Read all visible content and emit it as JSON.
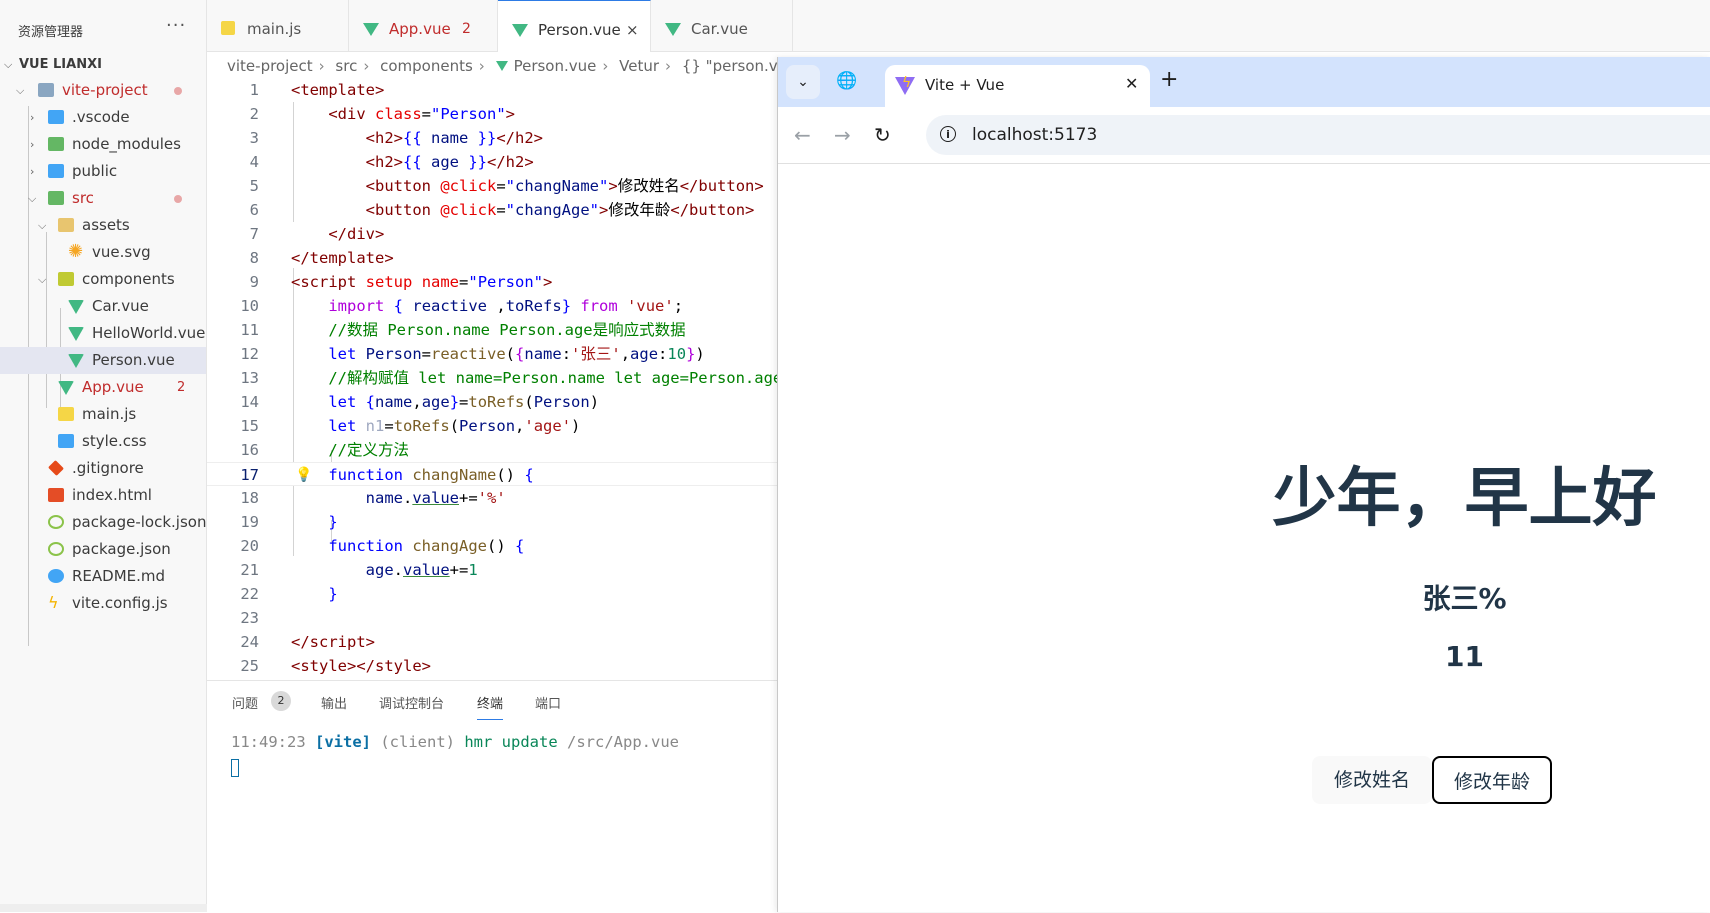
{
  "explorer": {
    "title": "资源管理器",
    "more": "···",
    "project": "VUE LIANXI",
    "tree": [
      {
        "label": "vite-project",
        "modified": true
      },
      {
        "label": ".vscode"
      },
      {
        "label": "node_modules"
      },
      {
        "label": "public"
      },
      {
        "label": "src",
        "modified": true
      },
      {
        "label": "assets"
      },
      {
        "label": "vue.svg"
      },
      {
        "label": "components"
      },
      {
        "label": "Car.vue"
      },
      {
        "label": "HelloWorld.vue"
      },
      {
        "label": "Person.vue"
      },
      {
        "label": "App.vue",
        "badge": "2"
      },
      {
        "label": "main.js"
      },
      {
        "label": "style.css"
      },
      {
        "label": ".gitignore"
      },
      {
        "label": "index.html"
      },
      {
        "label": "package-lock.json"
      },
      {
        "label": "package.json"
      },
      {
        "label": "README.md"
      },
      {
        "label": "vite.config.js"
      }
    ]
  },
  "tabs": [
    {
      "label": "main.js",
      "icon": "js-icon"
    },
    {
      "label": "App.vue",
      "icon": "vue-icon",
      "badge": "2"
    },
    {
      "label": "Person.vue",
      "icon": "vue-icon",
      "close": "×"
    },
    {
      "label": "Car.vue",
      "icon": "vue-icon"
    }
  ],
  "breadcrumb": [
    "vite-project",
    "src",
    "components",
    "Person.vue",
    "Vetur",
    "{} \"person.vue\""
  ],
  "editor": {
    "current_line": "17",
    "line_numbers": [
      "1",
      "2",
      "3",
      "4",
      "5",
      "6",
      "7",
      "8",
      "9",
      "10",
      "11",
      "12",
      "13",
      "14",
      "15",
      "16",
      "17",
      "18",
      "19",
      "20",
      "21",
      "22",
      "23",
      "24",
      "25"
    ]
  },
  "panel": {
    "tabs": [
      "问题",
      "输出",
      "调试控制台",
      "终端",
      "端口"
    ],
    "problems_count": "2",
    "terminal": {
      "time": "11:49:23",
      "tag": "[vite]",
      "client": "(client)",
      "msg": "hmr update",
      "path": "/src/App.vue"
    }
  },
  "browser": {
    "tab_title": "Vite + Vue",
    "tab_close": "✕",
    "new_tab": "+",
    "url": "localhost:5173",
    "page": {
      "heading": "少年，早上好",
      "name": "张三%",
      "age": "11",
      "btn_name": "修改姓名",
      "btn_age": "修改年龄"
    }
  },
  "colors": {
    "accent": "#2d7be5",
    "vue_green": "#41b883",
    "modified_red": "#c02c2c",
    "browser_tabstrip": "#d3e3fd"
  }
}
